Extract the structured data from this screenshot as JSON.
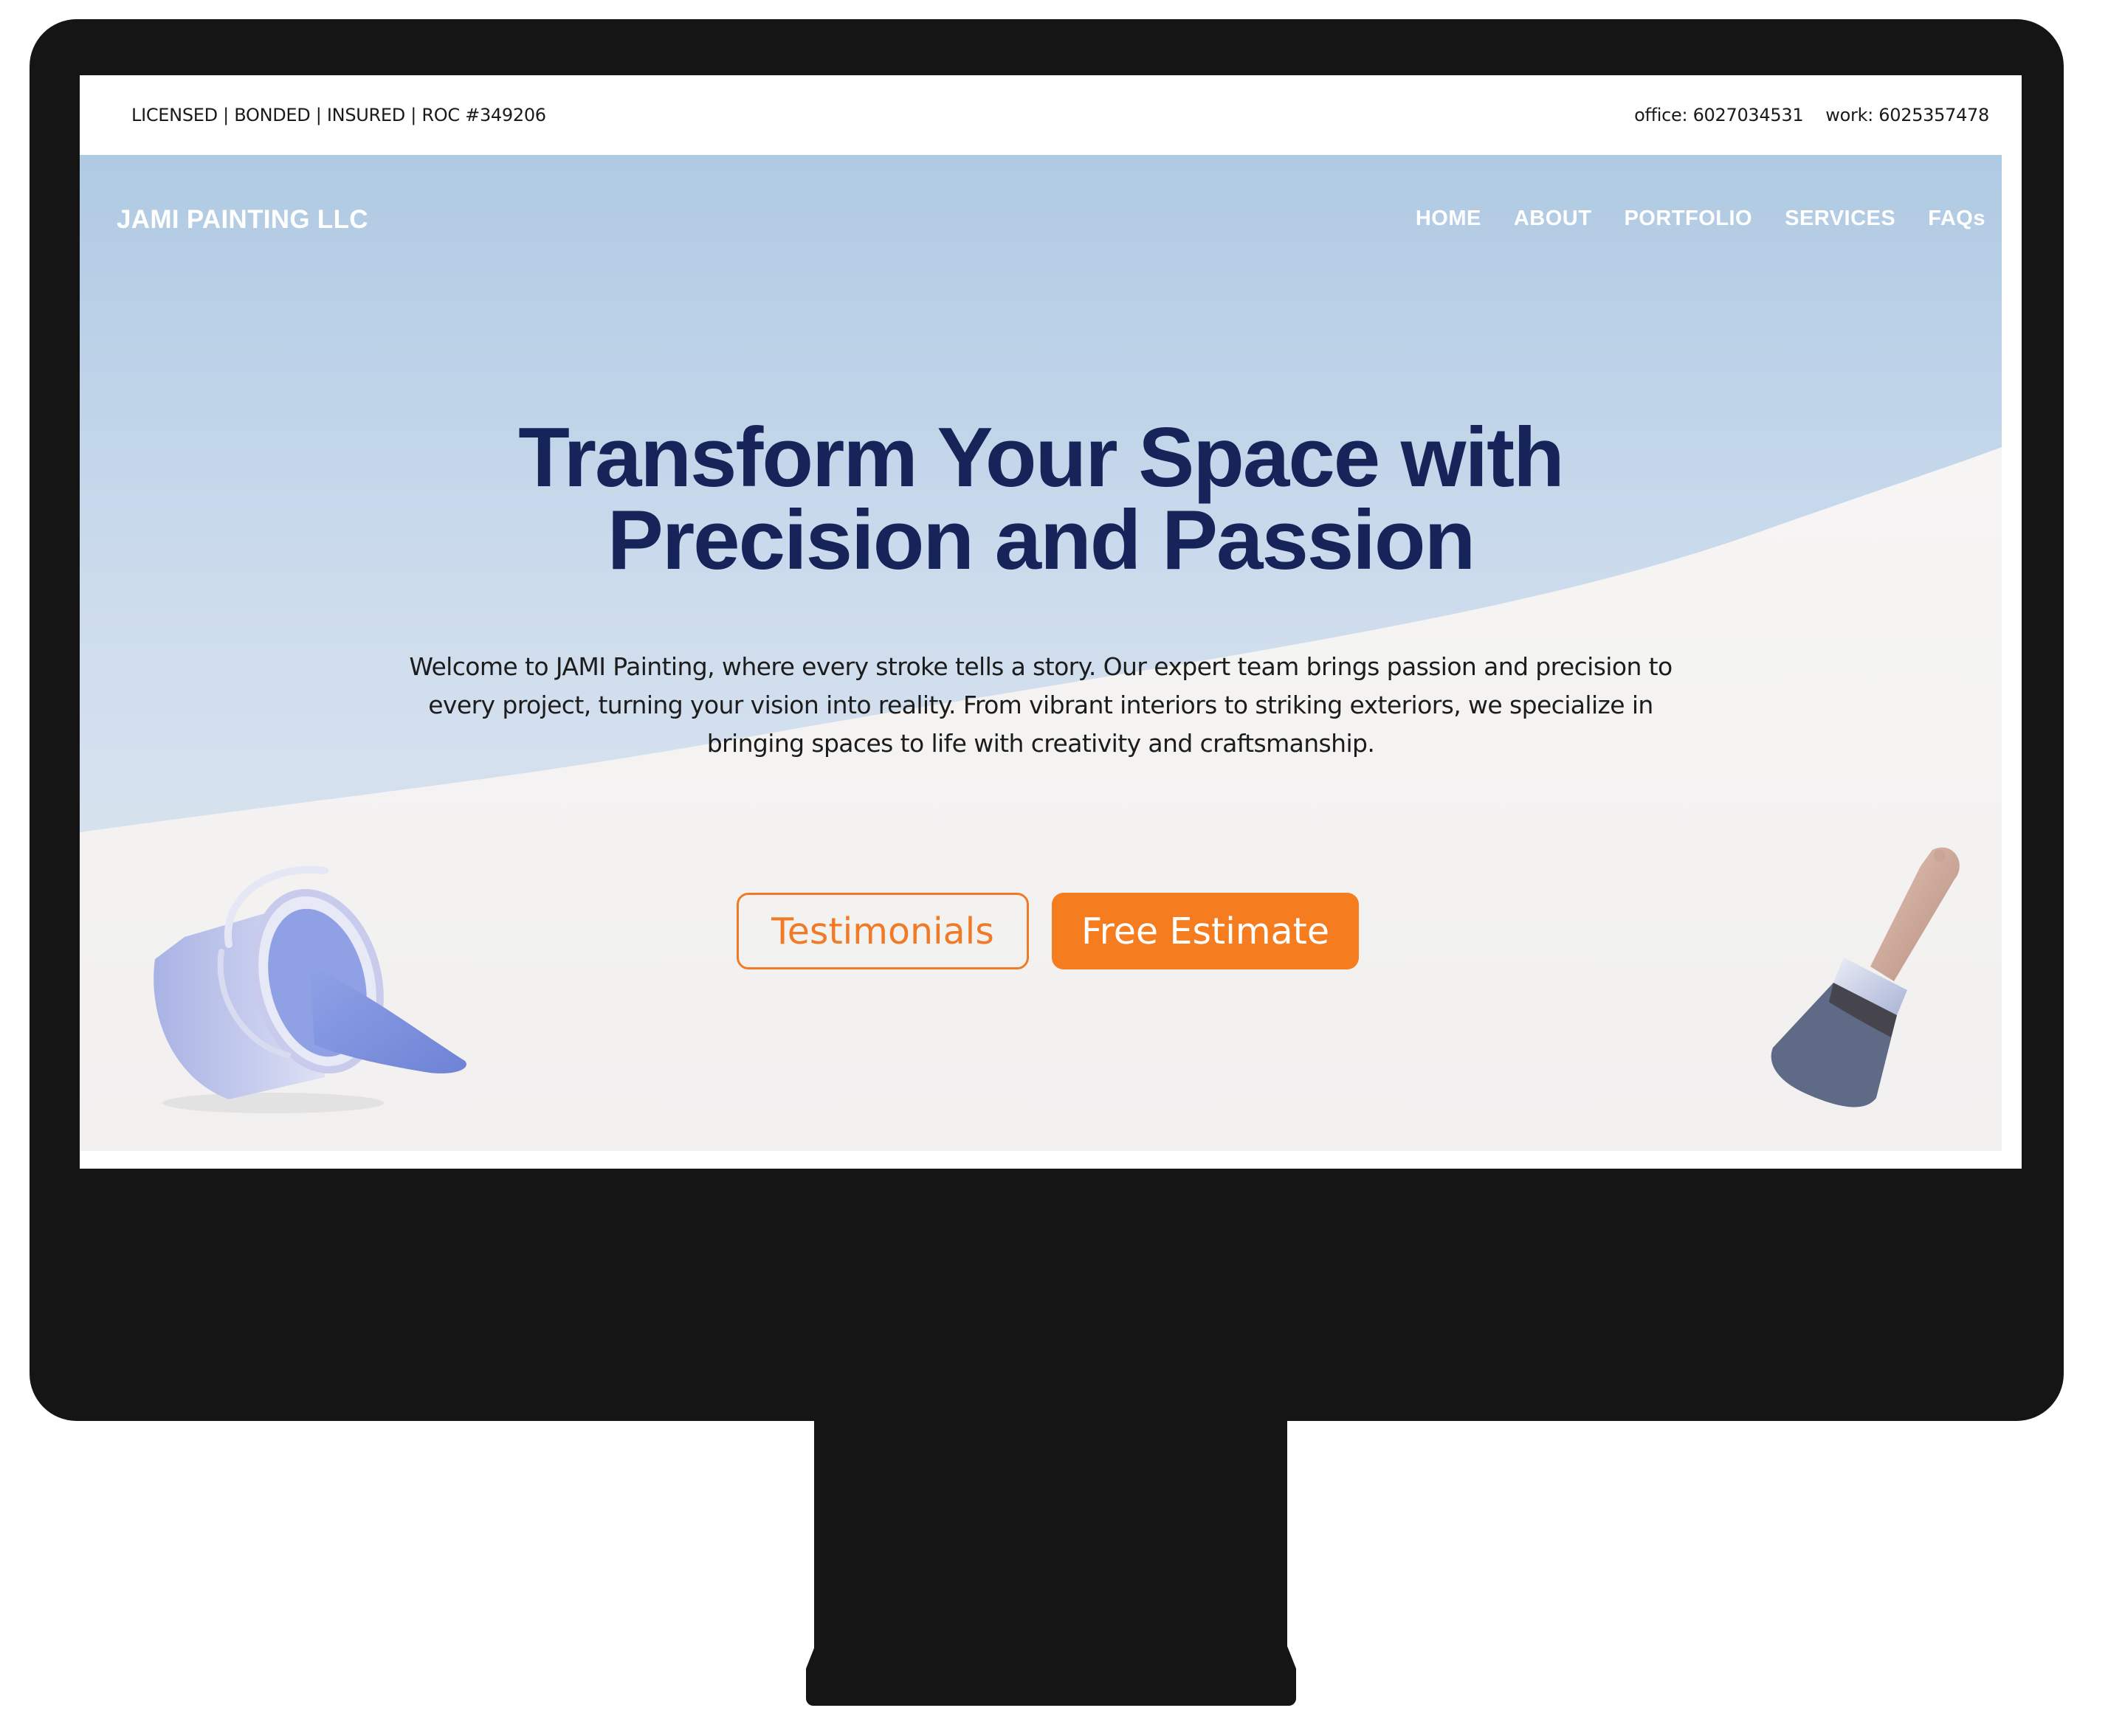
{
  "topbar": {
    "credentials": "LICENSED | BONDED | INSURED | ROC #349206",
    "office": "office: 6027034531",
    "work": "work: 6025357478"
  },
  "nav": {
    "brand": "JAMI PAINTING LLC",
    "items": [
      {
        "label": "HOME"
      },
      {
        "label": "ABOUT"
      },
      {
        "label": "PORTFOLIO"
      },
      {
        "label": "SERVICES"
      },
      {
        "label": "FAQs"
      }
    ]
  },
  "hero": {
    "headline_line1": "Transform Your Space with",
    "headline_line2": "Precision and Passion",
    "intro": "Welcome to JAMI Painting, where every stroke tells a story. Our expert team brings passion and precision to every project, turning your vision into reality. From vibrant interiors to striking exteriors, we specialize in bringing spaces to life with creativity and craftsmanship.",
    "buttons": {
      "testimonials": "Testimonials",
      "estimate": "Free Estimate"
    }
  },
  "colors": {
    "headline": "#16245a",
    "accent_orange": "#f57c1f",
    "sky_blue": "#b3cde4",
    "monitor_bezel": "#151515"
  },
  "icons": {
    "bucket": "paint-bucket-icon",
    "brush": "paint-brush-icon"
  }
}
